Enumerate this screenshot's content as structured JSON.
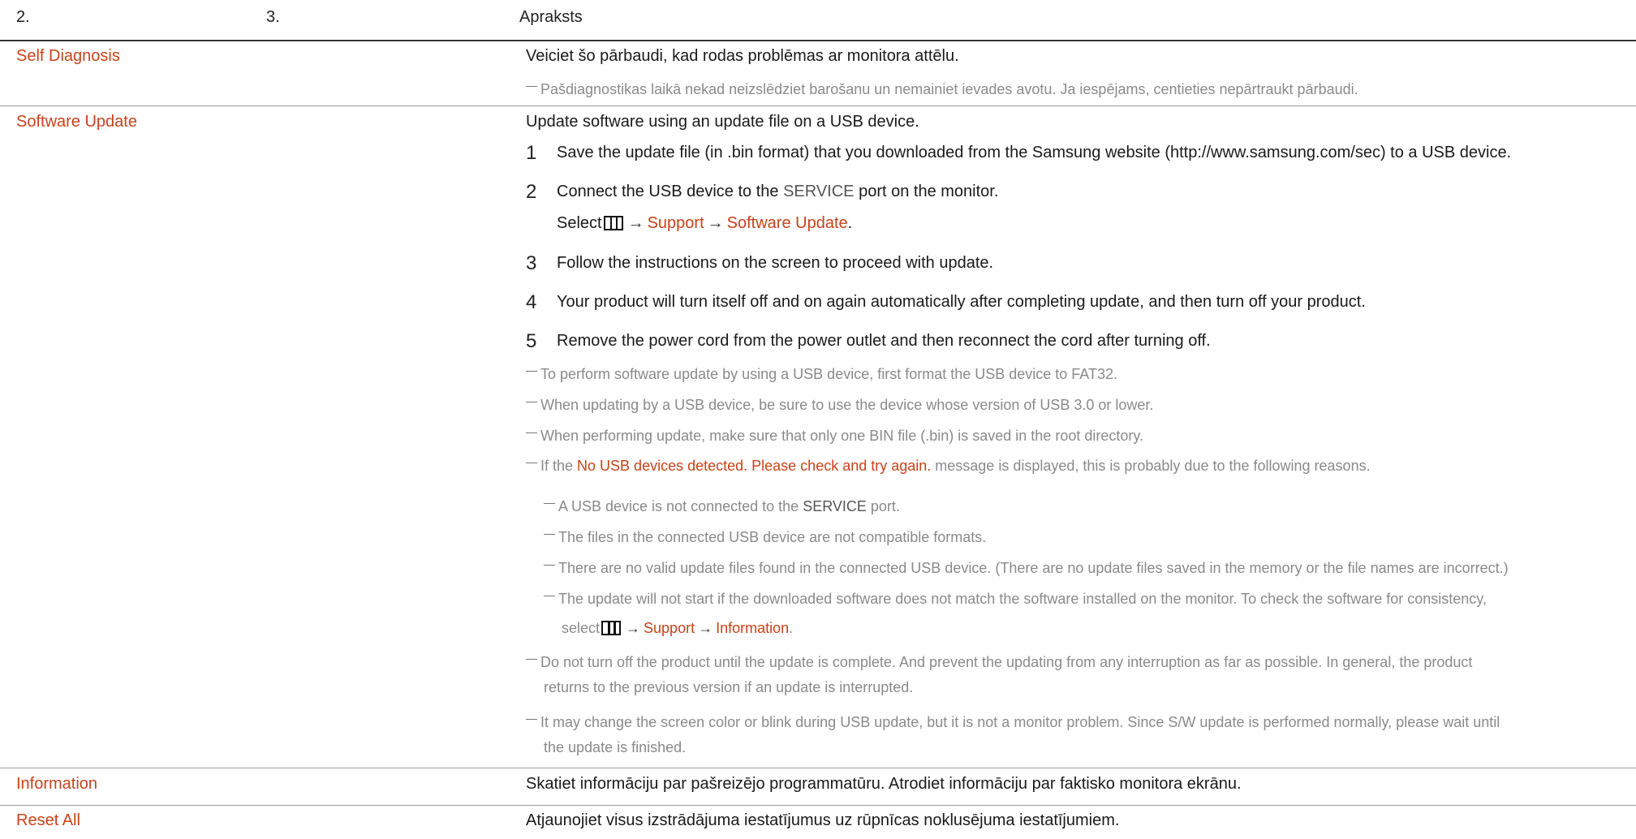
{
  "header": {
    "col1": "2.",
    "col2": "3.",
    "col3": "Apraksts"
  },
  "rows": {
    "self_diagnosis": {
      "label": "Self Diagnosis",
      "text": "Veiciet šo pārbaudi, kad rodas problēmas ar monitora attēlu.",
      "note": "Pašdiagnostikas laikā nekad neizslēdziet barošanu un nemainiet ievades avotu. Ja iespējams, centieties nepārtraukt pārbaudi."
    },
    "software_update": {
      "label": "Software Update",
      "intro": "Update software using an update file on a USB device.",
      "steps": [
        {
          "num": "1",
          "text": "Save the update file (in .bin format) that you downloaded from the Samsung website (http://www.samsung.com/sec) to a USB device."
        },
        {
          "num": "2",
          "text_before": "Connect the USB device to the ",
          "text_bold": "SERVICE",
          "text_after": " port on the monitor."
        },
        {
          "num": "3",
          "text": "Follow the instructions on the screen to proceed with update."
        },
        {
          "num": "4",
          "text": "Your product will turn itself off and on again automatically after completing update, and then turn off your product."
        },
        {
          "num": "5",
          "text": "Remove the power cord from the power outlet and then reconnect the cord after turning off."
        }
      ],
      "select_line": {
        "select": "Select",
        "arrow": "→",
        "support": "Support",
        "target": "Software Update",
        "period": "."
      },
      "notes": [
        "To perform software update by using a USB device, first format the USB device to FAT32.",
        "When updating by a USB device, be sure to use the device whose version of USB 3.0 or lower.",
        "When performing update, make sure that only one BIN file (.bin) is saved in the root directory."
      ],
      "if_note": {
        "before": "If the ",
        "message": "No USB devices detected. Please check and try again.",
        "after": " message is displayed, this is probably due to the following reasons."
      },
      "reasons": [
        {
          "before": "A USB device is not connected to the ",
          "bold": "SERVICE",
          "after": " port."
        },
        {
          "text": "The files in the connected USB device are not compatible formats."
        },
        {
          "text": "There are no valid update files found in the connected USB device. (There are no update files saved in the memory or the file names are incorrect.)"
        },
        {
          "text": "The update will not start if the downloaded software does not match the software installed on the monitor. To check the software for consistency,",
          "select": "select",
          "arrow": "→",
          "support": "Support",
          "target": "Information",
          "period": "."
        }
      ],
      "final_notes": [
        {
          "line1": "Do not turn off the product until the update is complete. And prevent the updating from any interruption as far as possible. In general, the product",
          "line2": "returns to the previous version if an update is interrupted."
        },
        {
          "line1": "It may change the screen color or blink during USB update, but it is not a monitor problem. Since S/W update is performed normally, please wait until",
          "line2": "the update is finished."
        }
      ]
    },
    "information": {
      "label": "Information",
      "text": "Skatiet informāciju par pašreizējo programmatūru. Atrodiet informāciju par faktisko monitora ekrānu."
    },
    "reset_all": {
      "label": "Reset All",
      "text": "Atjaunojiet visus izstrādājuma iestatījumus uz rūpnīcas noklusējuma iestatījumiem."
    }
  },
  "colors": {
    "accent": "#c8421a",
    "note_gray": "#8a8a8a",
    "text": "#1a1a1a"
  },
  "icons": {
    "menu": "menu-grid-icon",
    "arrow": "right-arrow"
  }
}
